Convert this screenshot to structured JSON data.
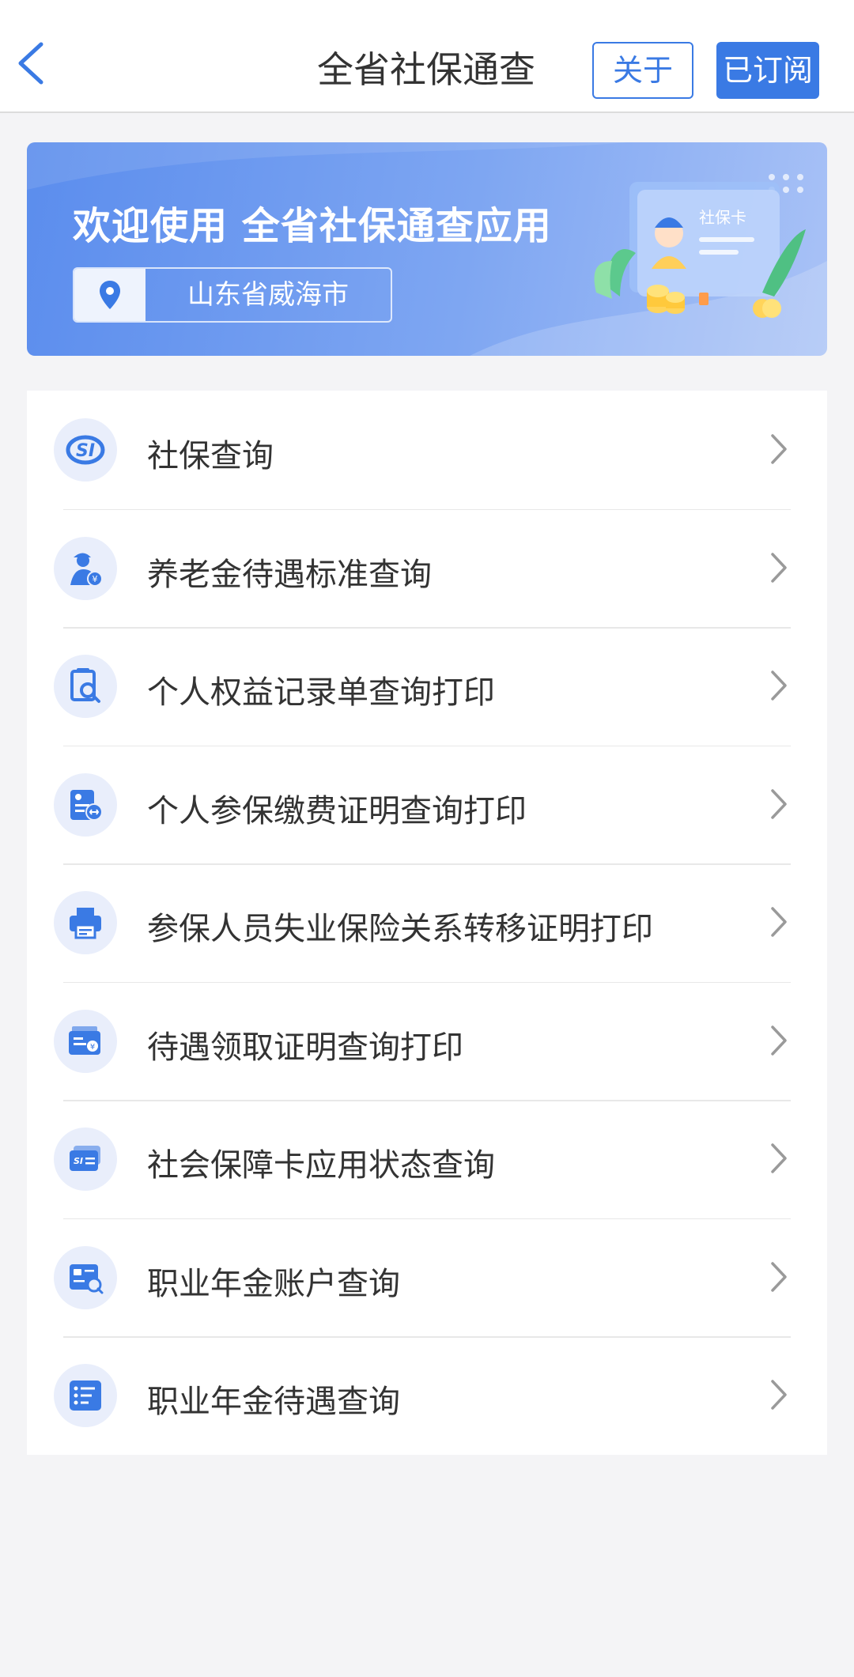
{
  "header": {
    "title": "全省社保通查",
    "about_label": "关于",
    "subscribed_label": "已订阅",
    "back_icon": "chevron-left-icon",
    "accent": "#3a7ae4"
  },
  "banner": {
    "title": "欢迎使用 全省社保通查应用",
    "location": "山东省威海市",
    "card_text": "社保卡",
    "location_icon": "map-pin-icon"
  },
  "menu": [
    {
      "label": "社保查询",
      "icon": "si-logo-icon"
    },
    {
      "label": "养老金待遇标准查询",
      "icon": "pensioner-icon"
    },
    {
      "label": "个人权益记录单查询打印",
      "icon": "record-search-icon"
    },
    {
      "label": "个人参保缴费证明查询打印",
      "icon": "payment-certificate-icon"
    },
    {
      "label": "参保人员失业保险关系转移证明打印",
      "icon": "printer-icon"
    },
    {
      "label": "待遇领取证明查询打印",
      "icon": "benefit-certificate-icon"
    },
    {
      "label": "社会保障卡应用状态查询",
      "icon": "card-icon"
    },
    {
      "label": "职业年金账户查询",
      "icon": "account-search-icon"
    },
    {
      "label": "职业年金待遇查询",
      "icon": "list-icon"
    }
  ]
}
